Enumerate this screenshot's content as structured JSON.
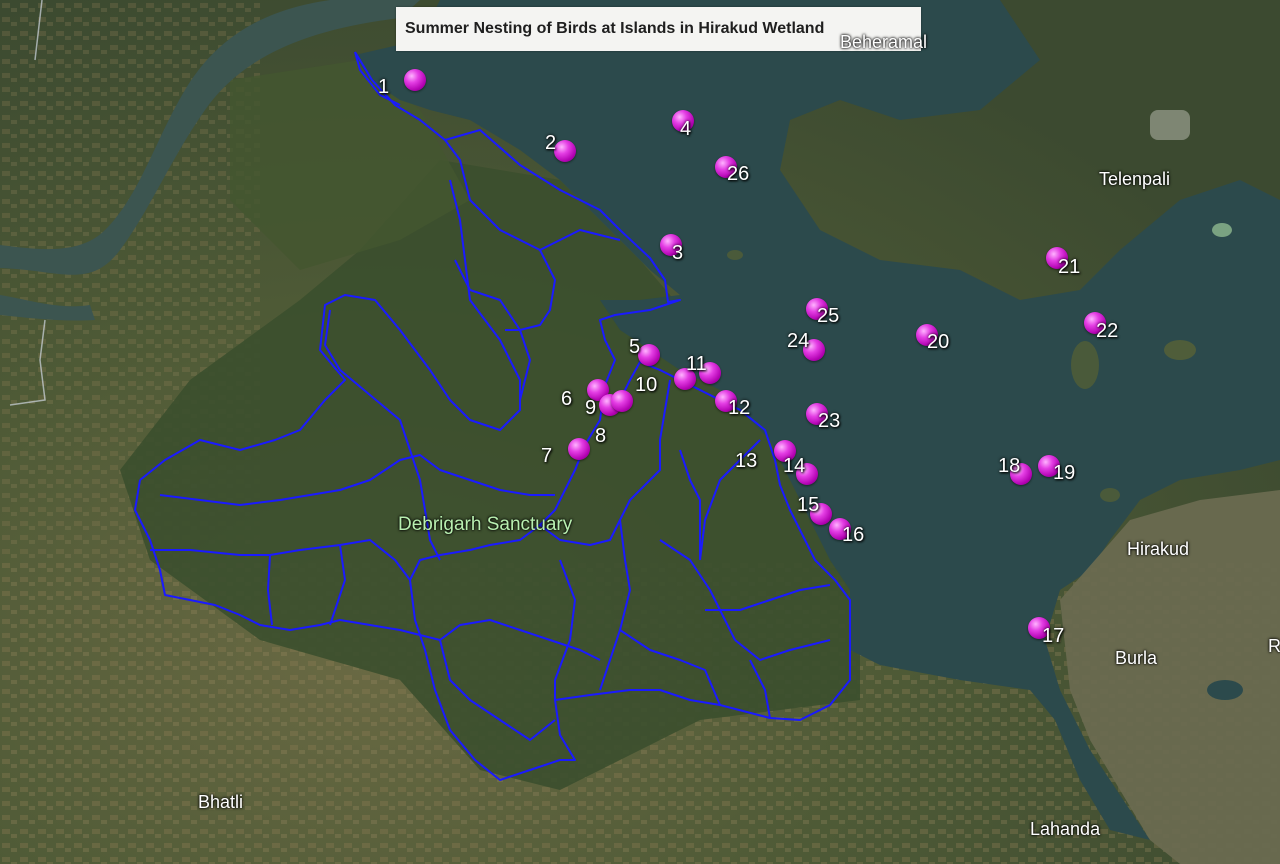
{
  "title": "Summer Nesting of Birds at Islands in Hirakud Wetland",
  "colors": {
    "marker": "#c020c8",
    "boundary": "#1a1aff",
    "water": "#2c4a4c"
  },
  "places": [
    {
      "name": "Beheramal"
    },
    {
      "name": "Telenpali"
    },
    {
      "name": "Debrigarh Sanctuary"
    },
    {
      "name": "Hirakud"
    },
    {
      "name": "Burla"
    },
    {
      "name": "Bhatli"
    },
    {
      "name": "Lahanda"
    },
    {
      "name": "R"
    }
  ],
  "islands": [
    "1",
    "2",
    "3",
    "4",
    "5",
    "6",
    "7",
    "8",
    "9",
    "10",
    "11",
    "12",
    "13",
    "14",
    "15",
    "16",
    "17",
    "18",
    "19",
    "20",
    "21",
    "22",
    "23",
    "24",
    "25",
    "26"
  ]
}
